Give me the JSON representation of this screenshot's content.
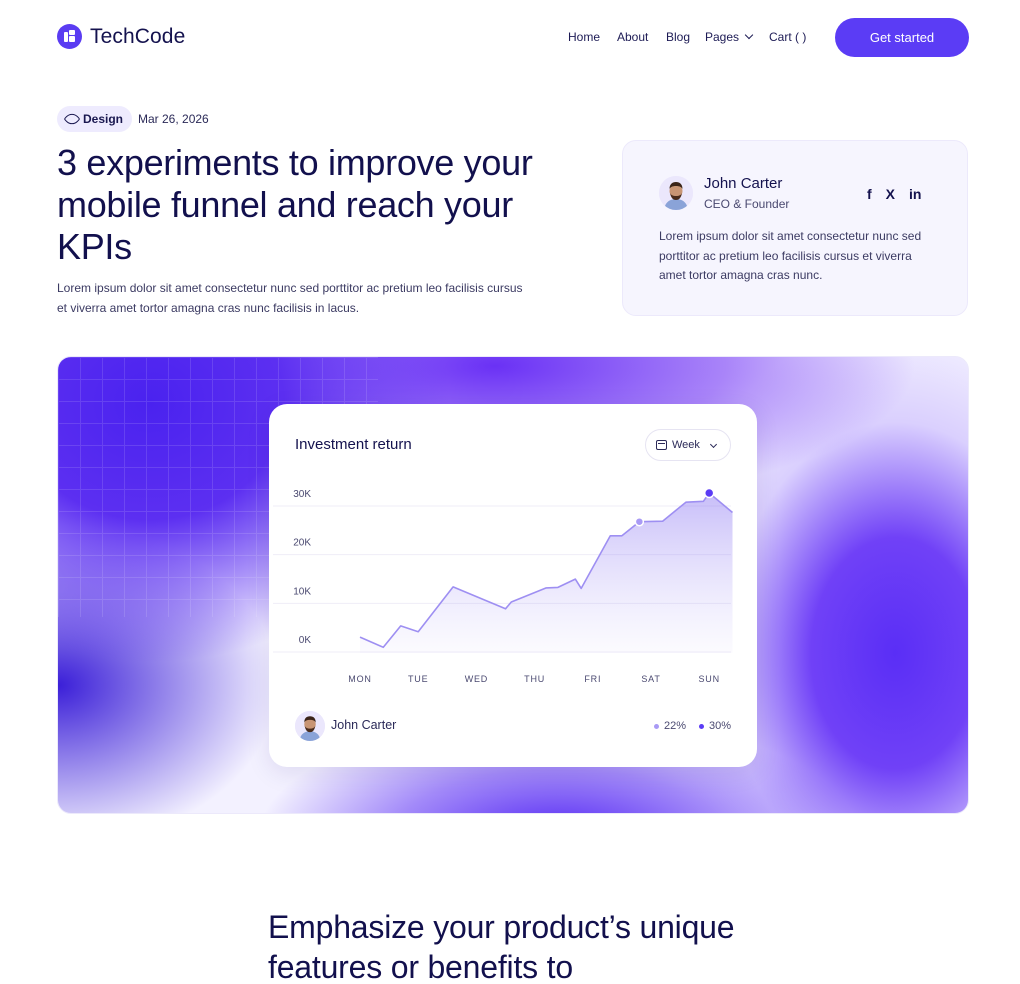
{
  "brand": {
    "name": "TechCode",
    "accent": "#5b3cf5"
  },
  "nav": {
    "links": [
      {
        "label": "Home"
      },
      {
        "label": "About"
      },
      {
        "label": "Blog"
      },
      {
        "label": "Pages"
      },
      {
        "label": "Cart ( )"
      }
    ],
    "cta_label": "Get started"
  },
  "post": {
    "tag": "Design",
    "date": "Mar 26, 2026",
    "title": "3 experiments to improve your mobile funnel and reach your KPIs",
    "subtitle": "Lorem ipsum dolor sit amet consectetur nunc sed porttitor ac pretium leo facilisis cursus et viverra amet tortor amagna cras nunc facilisis in lacus."
  },
  "author": {
    "name": "John Carter",
    "role": "CEO & Founder",
    "bio": "Lorem ipsum dolor sit amet consectetur nunc sed porttitor ac pretium leo facilisis cursus et viverra amet tortor amagna cras nunc.",
    "socials": [
      "facebook-icon",
      "x-icon",
      "linkedin-icon"
    ],
    "social_glyphs": [
      "f",
      "X",
      "in"
    ]
  },
  "chart_card": {
    "title": "Investment return",
    "period": "Week",
    "user_name": "John Carter",
    "legend": [
      {
        "value": "22%",
        "color": "#a99af5"
      },
      {
        "value": "30%",
        "color": "#5b3cf5"
      }
    ]
  },
  "chart_data": {
    "type": "area",
    "title": "Investment return",
    "x": [
      "MON",
      "TUE",
      "WED",
      "THU",
      "FRI",
      "SAT",
      "SUN"
    ],
    "yticks": [
      "30K",
      "20K",
      "10K",
      "0K"
    ],
    "ylim": [
      0,
      30000
    ],
    "points": [
      [
        0.0,
        400
      ],
      [
        0.4,
        -1700
      ],
      [
        0.7,
        2700
      ],
      [
        1.0,
        1500
      ],
      [
        1.6,
        10700
      ],
      [
        2.5,
        6200
      ],
      [
        2.6,
        7600
      ],
      [
        3.2,
        10500
      ],
      [
        3.4,
        10600
      ],
      [
        3.7,
        12300
      ],
      [
        3.8,
        10400
      ],
      [
        4.3,
        21200
      ],
      [
        4.5,
        21200
      ],
      [
        4.8,
        24100
      ],
      [
        5.2,
        24200
      ],
      [
        5.6,
        28100
      ],
      [
        5.9,
        28300
      ],
      [
        6.0,
        30000
      ],
      [
        6.4,
        26000
      ]
    ],
    "highlights": [
      [
        4.8,
        24100
      ],
      [
        6.0,
        30000
      ]
    ],
    "grid": true
  },
  "section": {
    "title": "Emphasize your product’s unique features or benefits to"
  }
}
